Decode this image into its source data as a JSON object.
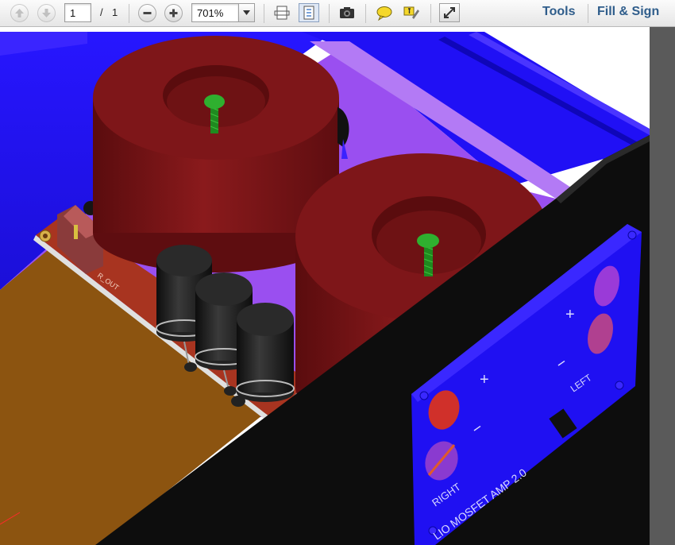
{
  "toolbar": {
    "prev_page_icon": "arrow-up-icon",
    "next_page_icon": "arrow-down-icon",
    "page_current": "1",
    "page_separator": "/",
    "page_total": "1",
    "zoom_value": "701%",
    "menu_tools": "Tools",
    "menu_fill_sign": "Fill & Sign"
  },
  "board": {
    "label_r_out": "R_OUT"
  },
  "panel": {
    "label_plus_right": "+",
    "label_minus_right": "−",
    "label_right": "RIGHT",
    "label_plus_left": "+",
    "label_minus_left": "−",
    "label_left": "LEFT",
    "label_model": "LIO MOSFET AMP 2.0"
  },
  "colors": {
    "enclosure_blue": "#1f10f2",
    "floor_purple": "#9a4ff0",
    "toroid_red": "#7a1417",
    "pcb_red": "#a83420",
    "board_brown": "#8c5410",
    "screw_green": "#28a028",
    "panel_black": "#0d0d0d"
  }
}
